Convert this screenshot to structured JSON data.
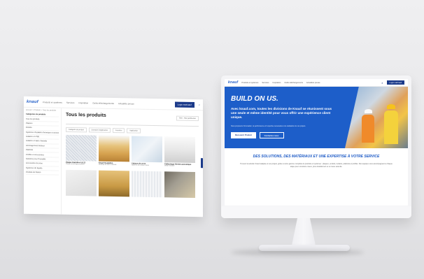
{
  "brand": {
    "logo": "knauf",
    "accent": "#1e5bc6",
    "dark": "#1b3a8a"
  },
  "catalog_page": {
    "nav": [
      "Produits et systèmes",
      "Services",
      "Inspiration",
      "Outils téléchargements",
      "Actualités presse"
    ],
    "login": "Login maKnauf",
    "breadcrumb": "Accueil  >  Produits  >  Tous les produits",
    "sidebar": [
      "Catégories de produits",
      "Tous les produits",
      "Plaques",
      "Enduits",
      "Systèmes d'isolation thermique et acoustique",
      "Isolation en PSE",
      "Isolation en laine minérale",
      "Aménagement intérieur",
      "Plafonds",
      "Profilés et accessoires",
      "Solutions pour l'humidité",
      "Accessoires de pose",
      "Systèmes de façade",
      "Produits de finition"
    ],
    "title": "Tous les produits",
    "sort": "Trier : Par pertinence",
    "filters": [
      "Catégorie de produit",
      "Domaine d'application",
      "Fonction",
      "Application"
    ],
    "products": [
      {
        "name": "Plaque Danoline 4.8.12",
        "sub": "Plaque acoustique perforée",
        "img": "c1"
      },
      {
        "name": "Knauf Insulation",
        "sub": "Rouleau de laine minérale",
        "img": "c2"
      },
      {
        "name": "Cloison de verre",
        "sub": "Système de cloison vitrée",
        "img": "c3"
      },
      {
        "name": "Calfeutrage thermo-acoustique",
        "sub": "Bande isolante",
        "img": "c4"
      },
      {
        "name": "",
        "sub": "",
        "img": "c5"
      },
      {
        "name": "",
        "sub": "",
        "img": "c6"
      },
      {
        "name": "",
        "sub": "",
        "img": "c7"
      },
      {
        "name": "",
        "sub": "",
        "img": "c8"
      }
    ]
  },
  "home_page": {
    "nav": [
      "Produits et systèmes",
      "Services",
      "Inspiration",
      "Outils téléchargements",
      "Actualités presse"
    ],
    "login": "Login maKnauf",
    "hero": {
      "title": "BUILD ON US.",
      "text": "Avec knauf.com, toutes les divisions de Knauf se réunissent sous une seule et même identité pour vous offrir une expérience client unique.",
      "small": "Nous proposons l'innovation, la performance et l'expertise nécessaires à la réalisation de vos projets.",
      "btn_primary": "Découvrir Produit",
      "btn_secondary": "Contactez-nous"
    },
    "section": {
      "title": "DES SOLUTIONS, DES MATÉRIAUX ET UNE EXPERTISE À VOTRE SERVICE",
      "text": "Trouvez la solution Knauf adaptée à vos projets, grâce à notre gamme complète de produits et systèmes : plaques, enduits, isolants, plafonds et profilés. Nos équipes vous accompagnent à chaque étape pour construire mieux, plus durablement et en toute sérénité."
    }
  }
}
